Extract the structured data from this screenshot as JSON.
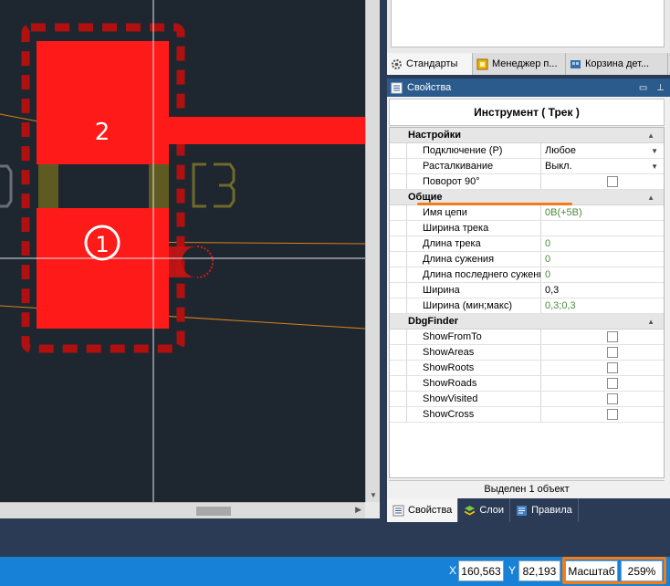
{
  "canvas": {
    "pad_labels": [
      "2",
      "1"
    ],
    "colors": {
      "copper": "#ff1a1a",
      "keepout": "#b01010",
      "olive": "#5e5a22",
      "ratsnest": "#d9821e"
    }
  },
  "tabs_top": [
    {
      "icon": "gear-icon",
      "label": "Стандарты"
    },
    {
      "icon": "component-manager-icon",
      "label": "Менеджер п..."
    },
    {
      "icon": "cart-icon",
      "label": "Корзина дет..."
    }
  ],
  "properties": {
    "title": "Свойства",
    "tool_title": "Инструмент ( Трек )",
    "categories": [
      {
        "name": "Настройки",
        "rows": [
          {
            "label": "Подключение (P)",
            "value": "Любое",
            "type": "dropdown"
          },
          {
            "label": "Расталкивание",
            "value": "Выкл.",
            "type": "dropdown"
          },
          {
            "label": "Поворот 90°",
            "value": "",
            "type": "checkbox"
          }
        ]
      },
      {
        "name": "Общие",
        "rows": [
          {
            "label": "Имя цепи",
            "value": "0B(+5B)",
            "type": "readonly"
          },
          {
            "label": "Ширина трека",
            "value": "",
            "type": "text"
          },
          {
            "label": "Длина трека",
            "value": "0",
            "type": "readonly"
          },
          {
            "label": "Длина сужения",
            "value": "0",
            "type": "readonly"
          },
          {
            "label": "Длина последнего сужения",
            "value": "0",
            "type": "readonly"
          },
          {
            "label": "Ширина",
            "value": "0,3",
            "type": "text"
          },
          {
            "label": "Ширина (мин;макс)",
            "value": "0,3;0,3",
            "type": "readonly"
          }
        ]
      },
      {
        "name": "DbgFinder",
        "rows": [
          {
            "label": "ShowFromTo",
            "value": "",
            "type": "checkbox"
          },
          {
            "label": "ShowAreas",
            "value": "",
            "type": "checkbox"
          },
          {
            "label": "ShowRoots",
            "value": "",
            "type": "checkbox"
          },
          {
            "label": "ShowRoads",
            "value": "",
            "type": "checkbox"
          },
          {
            "label": "ShowVisited",
            "value": "",
            "type": "checkbox"
          },
          {
            "label": "ShowCross",
            "value": "",
            "type": "checkbox"
          }
        ]
      }
    ],
    "status": "Выделен 1 объект"
  },
  "tabs_bottom": [
    {
      "icon": "properties-icon",
      "label": "Свойства"
    },
    {
      "icon": "layers-icon",
      "label": "Слои"
    },
    {
      "icon": "rules-icon",
      "label": "Правила"
    }
  ],
  "statusbar": {
    "x_label": "X",
    "x_value": "160,563",
    "y_label": "Y",
    "y_value": "82,193",
    "zoom_label": "Масштаб",
    "zoom_value": "259%"
  }
}
